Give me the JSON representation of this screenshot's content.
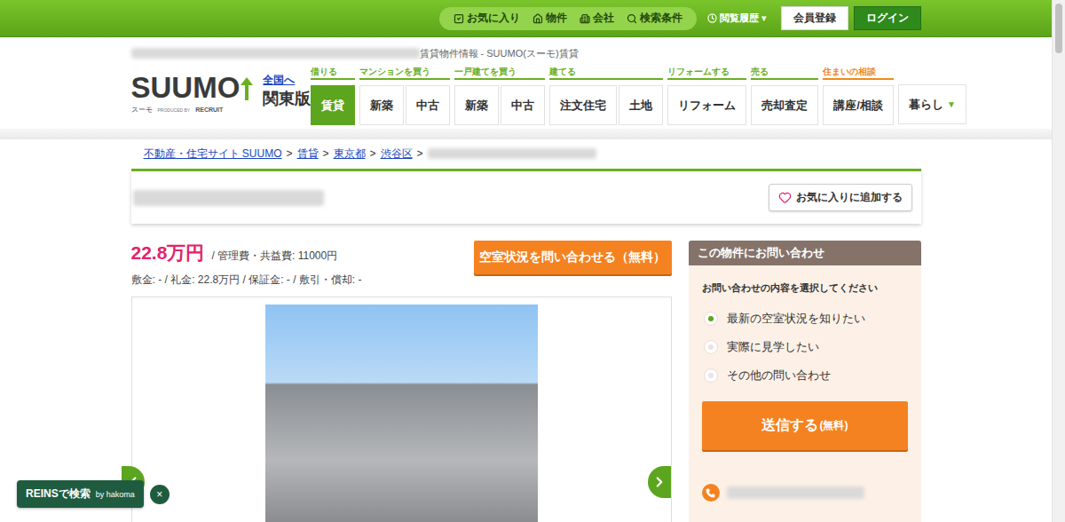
{
  "topbar": {
    "links": [
      {
        "label": "お気に入り"
      },
      {
        "label": "物件"
      },
      {
        "label": "会社"
      },
      {
        "label": "検索条件"
      }
    ],
    "history": "閲覧履歴",
    "history_caret": "▾",
    "register": "会員登録",
    "login": "ログイン"
  },
  "page_title": "賃貸物件情報 - SUUMO(スーモ)賃貸",
  "logo": {
    "text": "SUUMO",
    "kana": "スーモ",
    "produced": "PRODUCED BY",
    "company": "RECRUIT"
  },
  "region": {
    "link": "全国へ",
    "name": "関東版"
  },
  "nav": [
    {
      "label": "借りる",
      "color": "#6ab01e",
      "items": [
        {
          "label": "賃貸",
          "selected": true
        }
      ]
    },
    {
      "label": "マンションを買う",
      "color": "#6ab01e",
      "items": [
        {
          "label": "新築",
          "selected": false
        },
        {
          "label": "中古",
          "selected": false
        }
      ]
    },
    {
      "label": "一戸建てを買う",
      "color": "#6ab01e",
      "items": [
        {
          "label": "新築",
          "selected": false
        },
        {
          "label": "中古",
          "selected": false
        }
      ]
    },
    {
      "label": "建てる",
      "color": "#6ab01e",
      "items": [
        {
          "label": "注文住宅",
          "selected": false
        },
        {
          "label": "土地",
          "selected": false
        }
      ]
    },
    {
      "label": "リフォームする",
      "color": "#6ab01e",
      "items": [
        {
          "label": "リフォーム",
          "selected": false
        }
      ]
    },
    {
      "label": "売る",
      "color": "#6ab01e",
      "items": [
        {
          "label": "売却査定",
          "selected": false
        }
      ]
    },
    {
      "label": "住まいの相談",
      "color": "#f08a1c",
      "items": [
        {
          "label": "講座/相談",
          "selected": false
        }
      ]
    },
    {
      "label": "",
      "color": "#ffffff",
      "items": [
        {
          "label": "暮らし",
          "selected": false,
          "caret": "▼"
        }
      ]
    }
  ],
  "breadcrumb": {
    "items": [
      "不動産・住宅サイト SUUMO",
      "賃貸",
      "東京都",
      "渋谷区"
    ],
    "separator": ">"
  },
  "favorite_button": "お気に入りに追加する",
  "price": {
    "rent": "22.8万円",
    "fee": "/ 管理費・共益費: 11000円",
    "deposits": "敷金: - / 礼金: 22.8万円 / 保証金: - / 敷引・償却: -"
  },
  "vacancy_button": "空室状況を問い合わせる（無料）",
  "contact": {
    "title": "この物件にお問い合わせ",
    "prompt": "お問い合わせの内容を選択してください",
    "options": [
      {
        "label": "最新の空室状況を知りたい",
        "selected": true
      },
      {
        "label": "実際に見学したい",
        "selected": false
      },
      {
        "label": "その他の問い合わせ",
        "selected": false
      }
    ],
    "submit": "送信する",
    "submit_note": "(無料)"
  },
  "reins": {
    "label": "REINSで検索",
    "by": "by hakoma",
    "close": "×"
  }
}
